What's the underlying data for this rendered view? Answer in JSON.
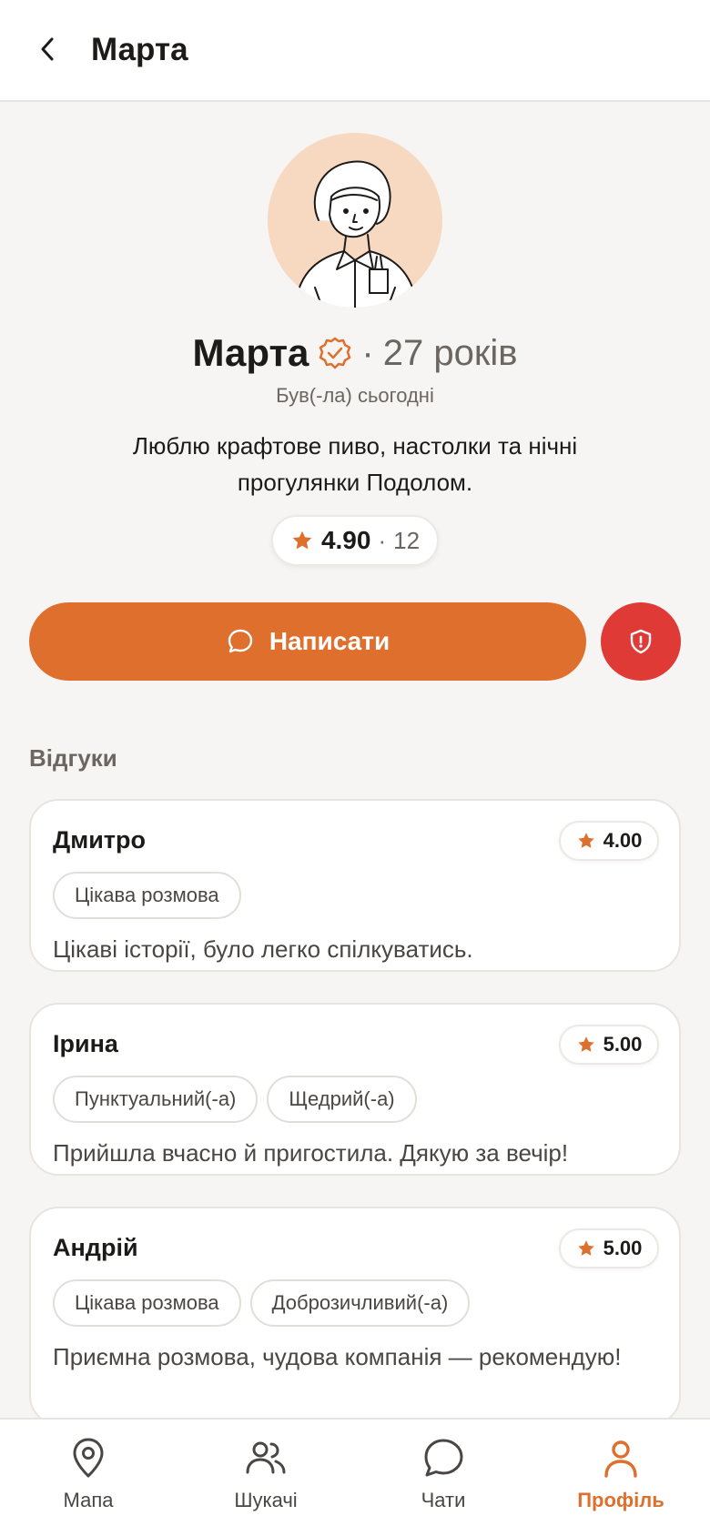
{
  "header": {
    "title": "Марта"
  },
  "profile": {
    "name": "Марта",
    "separator": "·",
    "age": "27 років",
    "last_seen": "Був(-ла) сьогодні",
    "bio": "Люблю крафтове пиво, настолки та нічні прогулянки Подолом.",
    "rating": "4.90",
    "rating_sep": "·",
    "rating_count": "12"
  },
  "actions": {
    "write_label": "Написати"
  },
  "reviews_section": {
    "title": "Відгуки"
  },
  "reviews": [
    {
      "name": "Дмитро",
      "rating": "4.00",
      "tags": [
        "Цікава розмова"
      ],
      "text": "Цікаві історії, було легко спілкуватись."
    },
    {
      "name": "Ірина",
      "rating": "5.00",
      "tags": [
        "Пунктуальний(-а)",
        "Щедрий(-а)"
      ],
      "text": "Прийшла вчасно й пригостила. Дякую за вечір!"
    },
    {
      "name": "Андрій",
      "rating": "5.00",
      "tags": [
        "Цікава розмова",
        "Доброзичливий(-а)"
      ],
      "text": "Приємна розмова, чудова компанія — рекомендую!"
    }
  ],
  "nav": {
    "items": [
      {
        "label": "Мапа",
        "icon": "map-pin-icon"
      },
      {
        "label": "Шукачі",
        "icon": "users-icon"
      },
      {
        "label": "Чати",
        "icon": "chat-icon"
      },
      {
        "label": "Профіль",
        "icon": "profile-icon"
      }
    ],
    "active": "Профіль"
  },
  "colors": {
    "accent": "#de6f2d",
    "danger": "#e03a36",
    "avatar_bg": "#f7d9c2",
    "background": "#f7f5f3"
  }
}
